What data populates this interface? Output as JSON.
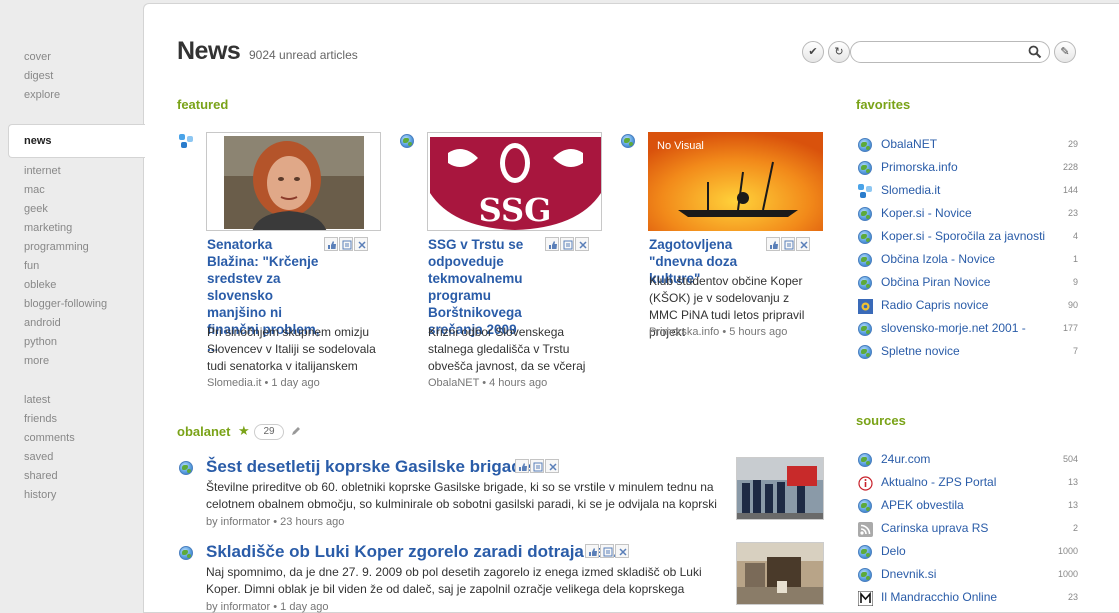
{
  "sidebar": {
    "group1": [
      "cover",
      "digest",
      "explore"
    ],
    "active": "news",
    "group2": [
      "internet",
      "mac",
      "geek",
      "marketing",
      "programming",
      "fun",
      "obleke",
      "blogger-following",
      "android",
      "python",
      "more"
    ],
    "group3": [
      "latest",
      "friends",
      "comments",
      "saved",
      "shared",
      "history"
    ]
  },
  "header": {
    "title": "News",
    "unread": "9024 unread articles",
    "search_placeholder": "",
    "mark_icon": "check-icon",
    "refresh_icon": "refresh-icon",
    "search_icon": "search-icon",
    "edit_icon": "pencil-icon"
  },
  "featured": {
    "title": "featured",
    "items": [
      {
        "source_icon": "slomedia-icon",
        "headline": "Senatorka Blažina: \"Krčenje sredstev za slovensko manjšino ni finančni problem, ...",
        "snippet": "Pri sinočnjem skupnem omizju Slovencev v Italiji se sodelovala tudi senatorka v italijanskem",
        "meta": "Slomedia.it • 1 day ago"
      },
      {
        "source_icon": "globe-icon",
        "headline": "SSG v Trstu se odpoveduje tekmovalnemu programu Borštnikovega srečanja 2009",
        "snippet": "Krizni odbor Slovenskega stalnega gledališča v Trstu obvešča javnost, da se včeraj",
        "meta": "ObalaNET • 4 hours ago"
      },
      {
        "source_icon": "globe-icon",
        "image_label": "No Visual",
        "headline": "Zagotovljena \"dnevna doza kulture\"",
        "snippet": "Klub študentov občine Koper (KŠOK) je v sodelovanju z MMC PiNA tudi letos pripravil projekt",
        "meta": "Primorska.info • 5 hours ago"
      }
    ]
  },
  "obalanet": {
    "title": "obalanet",
    "star": "★",
    "count": "29",
    "articles": [
      {
        "headline": "Šest desetletij koprske Gasilske brigade",
        "snippet": "Številne prireditve ob 60. obletniki koprske Gasilske brigade, ki so se vrstile v minulem tednu na celotnem obalnem območju, so kulminirale ob sobotni gasilski paradi, ki se je odvijala na koprski",
        "meta": "by informator • 23 hours ago"
      },
      {
        "headline": "Skladišče ob Luki Koper zgorelo zaradi dotrajane ...",
        "snippet": "Naj spomnimo, da je dne 27. 9. 2009 ob pol desetih zagorelo iz enega izmed skladišč ob Luki Koper. Dimni oblak je bil viden že od daleč, saj je zapolnil ozračje velikega dela koprskega",
        "meta": "by informator • 1 day ago"
      }
    ]
  },
  "favorites": {
    "title": "favorites",
    "items": [
      {
        "name": "ObalaNET",
        "count": "29",
        "icon": "globe-icon"
      },
      {
        "name": "Primorska.info",
        "count": "228",
        "icon": "globe-icon"
      },
      {
        "name": "Slomedia.it",
        "count": "144",
        "icon": "slomedia-icon"
      },
      {
        "name": "Koper.si - Novice",
        "count": "23",
        "icon": "globe-icon"
      },
      {
        "name": "Koper.si - Sporočila za javnosti",
        "count": "4",
        "icon": "globe-icon"
      },
      {
        "name": "Občina Izola - Novice",
        "count": "1",
        "icon": "globe-icon"
      },
      {
        "name": "Občina Piran Novice",
        "count": "9",
        "icon": "globe-icon"
      },
      {
        "name": "Radio Capris novice",
        "count": "90",
        "icon": "radio-capris-icon"
      },
      {
        "name": "slovensko-morje.net 2001 -",
        "count": "177",
        "icon": "globe-icon"
      },
      {
        "name": "Spletne novice",
        "count": "7",
        "icon": "globe-icon"
      }
    ]
  },
  "sources": {
    "title": "sources",
    "items": [
      {
        "name": "24ur.com",
        "count": "504",
        "icon": "globe-icon"
      },
      {
        "name": "Aktualno - ZPS Portal",
        "count": "13",
        "icon": "info-icon"
      },
      {
        "name": "APEK obvestila",
        "count": "13",
        "icon": "globe-icon"
      },
      {
        "name": "Carinska uprava RS",
        "count": "2",
        "icon": "rss-icon"
      },
      {
        "name": "Delo",
        "count": "1000",
        "icon": "globe-icon"
      },
      {
        "name": "Dnevnik.si",
        "count": "1000",
        "icon": "globe-icon"
      },
      {
        "name": "Il Mandracchio Online",
        "count": "23",
        "icon": "m-logo-icon"
      }
    ]
  }
}
